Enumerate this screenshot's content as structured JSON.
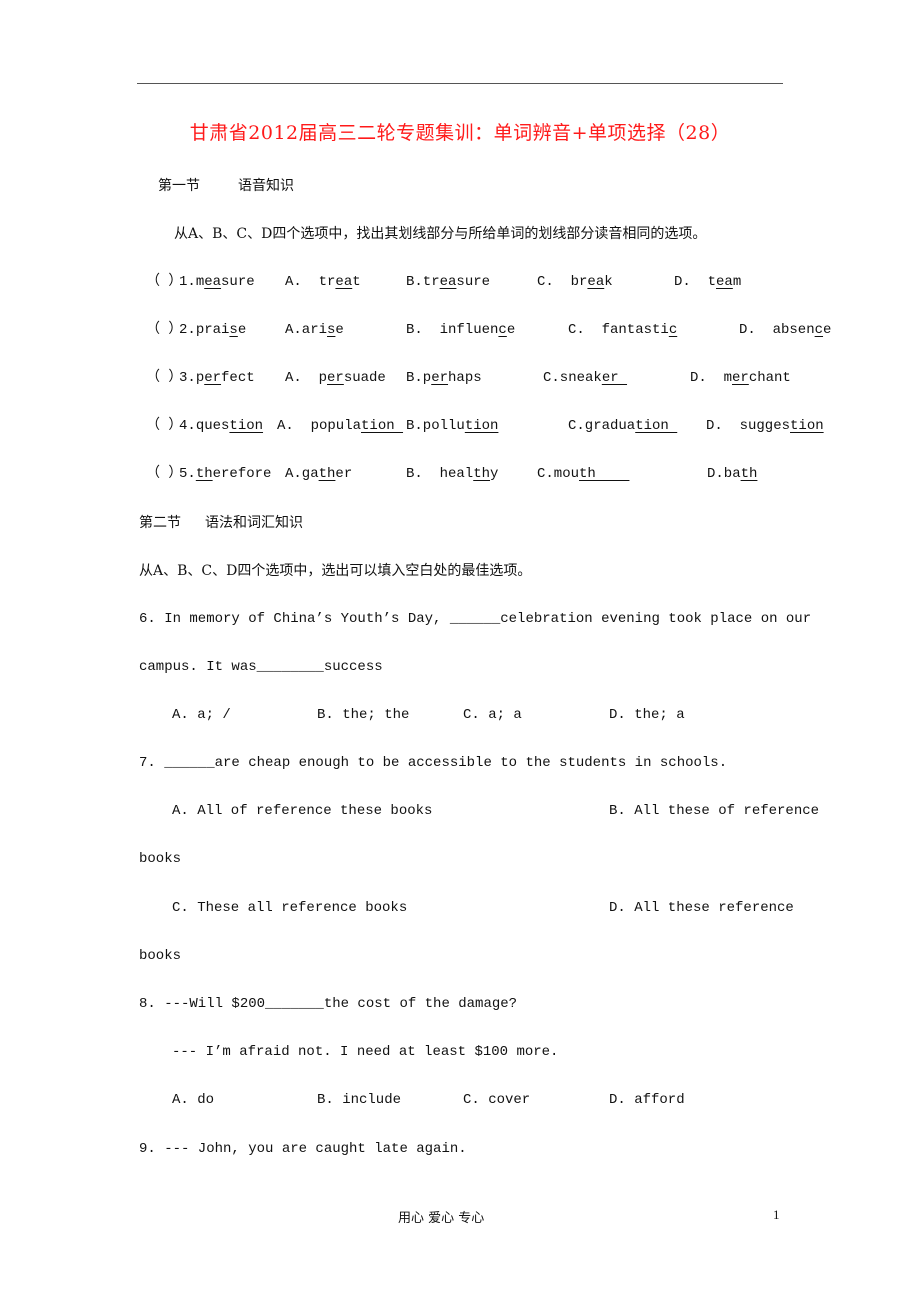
{
  "document": {
    "title": "甘肃省2012届高三二轮专题集训：单词辨音+单项选择（28）",
    "section1": {
      "heading_num": "第一节",
      "heading_name": "语音知识",
      "instruction": "从A、B、C、D四个选项中，找出其划线部分与所给单词的划线部分读音相同的选项。",
      "questions": [
        {
          "bracket": "（ ）",
          "num": "1.",
          "word_pre": "m",
          "word_u": "ea",
          "word_post": "sure",
          "A_pre": "A.  tr",
          "A_u": "ea",
          "A_post": "t",
          "B_pre": "B.tr",
          "B_u": "ea",
          "B_post": "sure",
          "C_pre": "C.  br",
          "C_u": "ea",
          "C_post": "k",
          "D_pre": "D.  t",
          "D_u": "ea",
          "D_post": "m"
        },
        {
          "bracket": "（ ）",
          "num": "2.",
          "word_pre": "prai",
          "word_u": "s",
          "word_post": "e",
          "A_pre": "A.ari",
          "A_u": "s",
          "A_post": "e",
          "B_pre": "B.  influen",
          "B_u": "c",
          "B_post": "e",
          "C_pre": "C.  fantasti",
          "C_u": "c",
          "C_post": "",
          "D_pre": "D.  absen",
          "D_u": "c",
          "D_post": "e"
        },
        {
          "bracket": "（ ）",
          "num": "3.",
          "word_pre": "p",
          "word_u": "er",
          "word_post": "fect",
          "A_pre": "A.  p",
          "A_u": "er",
          "A_post": "suade",
          "B_pre": "B.p",
          "B_u": "er",
          "B_post": "haps",
          "C_pre": "C.sneak",
          "C_u": "er ",
          "C_post": "",
          "D_pre": "D.  m",
          "D_u": "er",
          "D_post": "chant"
        },
        {
          "bracket": "（ ）",
          "num": "4.",
          "word_pre": "ques",
          "word_u": "tion",
          "word_post": "",
          "A_pre": "A.  popula",
          "A_u": "tion ",
          "A_post": "",
          "B_pre": "B.pollu",
          "B_u": "tion",
          "B_post": "",
          "C_pre": "C.gradua",
          "C_u": "tion ",
          "C_post": "",
          "D_pre": "D.  sugges",
          "D_u": "tion",
          "D_post": ""
        },
        {
          "bracket": "（ ）",
          "num": "5.",
          "word_pre": "",
          "word_u": "th",
          "word_post": "erefore",
          "A_pre": "A.ga",
          "A_u": "th",
          "A_post": "er",
          "B_pre": "B.  heal",
          "B_u": "th",
          "B_post": "y",
          "C_pre": "C.mou",
          "C_u": "th    ",
          "C_post": "",
          "D_pre": "D.ba",
          "D_u": "th",
          "D_post": ""
        }
      ]
    },
    "section2": {
      "heading_num": "第二节",
      "heading_name": "语法和词汇知识",
      "instruction": "从A、B、C、D四个选项中，选出可以填入空白处的最佳选项。",
      "q6": {
        "line1": "6. In memory of China’s Youth’s Day, ______celebration evening took place on our",
        "line2": "campus. It was________success",
        "A": "A. a; /",
        "B": "B. the; the",
        "C": "C. a; a",
        "D": "D. the; a"
      },
      "q7": {
        "line1": "7. ______are cheap enough to be accessible to the students in schools.",
        "A": "A. All of reference these books",
        "B": "B. All these of reference",
        "B_cont": "books",
        "C": "C. These all reference books",
        "D": "D. All these reference",
        "D_cont": "books"
      },
      "q8": {
        "line1": "8. ---Will $200_______the cost of the damage?",
        "line2": "--- I’m afraid not. I need at least $100 more.",
        "A": "A. do",
        "B": "B. include",
        "C": "C. cover",
        "D": "D. afford"
      },
      "q9": {
        "line1": "9. --- John, you are caught late again."
      }
    },
    "footer": {
      "slogan": "用心 爱心 专心",
      "page_number": "1"
    },
    "colors": {
      "title": "#ff1a1a",
      "text": "#111111",
      "rule": "#555555"
    }
  }
}
